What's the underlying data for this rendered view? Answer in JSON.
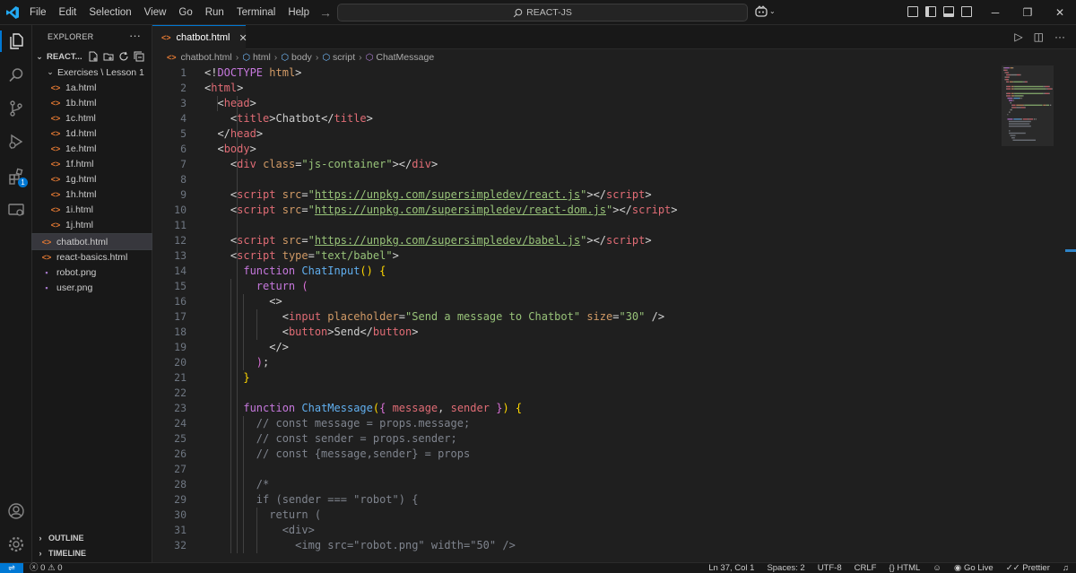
{
  "titlebar": {
    "menu": [
      "File",
      "Edit",
      "Selection",
      "View",
      "Go",
      "Run",
      "Terminal",
      "Help"
    ],
    "search": "REACT-JS"
  },
  "activity": {
    "extensions_badge": "1"
  },
  "sidebar": {
    "title": "EXPLORER",
    "root": "REACT...",
    "folder": "Exercises \\ Lesson 1",
    "files": [
      "1a.html",
      "1b.html",
      "1c.html",
      "1d.html",
      "1e.html",
      "1f.html",
      "1g.html",
      "1h.html",
      "1i.html",
      "1j.html"
    ],
    "root_files": [
      "chatbot.html",
      "react-basics.html",
      "robot.png",
      "user.png"
    ],
    "sections": [
      "OUTLINE",
      "TIMELINE"
    ]
  },
  "editor": {
    "tab": "chatbot.html",
    "breadcrumb": [
      "chatbot.html",
      "html",
      "body",
      "script",
      "ChatMessage"
    ],
    "lines": [
      [
        [
          "t-br",
          "<!"
        ],
        [
          "t-kw",
          "DOCTYPE"
        ],
        [
          "t-txt",
          " "
        ],
        [
          "t-attr",
          "html"
        ],
        [
          "t-br",
          ">"
        ]
      ],
      [
        [
          "t-br",
          "<"
        ],
        [
          "t-tag",
          "html"
        ],
        [
          "t-br",
          ">"
        ]
      ],
      [
        [
          "t-txt",
          "  "
        ],
        [
          "t-br",
          "<"
        ],
        [
          "t-tag",
          "head"
        ],
        [
          "t-br",
          ">"
        ]
      ],
      [
        [
          "t-txt",
          "    "
        ],
        [
          "t-br",
          "<"
        ],
        [
          "t-tag",
          "title"
        ],
        [
          "t-br",
          ">"
        ],
        [
          "t-txt",
          "Chatbot"
        ],
        [
          "t-br",
          "</"
        ],
        [
          "t-tag",
          "title"
        ],
        [
          "t-br",
          ">"
        ]
      ],
      [
        [
          "t-txt",
          "  "
        ],
        [
          "t-br",
          "</"
        ],
        [
          "t-tag",
          "head"
        ],
        [
          "t-br",
          ">"
        ]
      ],
      [
        [
          "t-txt",
          "  "
        ],
        [
          "t-br",
          "<"
        ],
        [
          "t-tag",
          "body"
        ],
        [
          "t-br",
          ">"
        ]
      ],
      [
        [
          "t-txt",
          "    "
        ],
        [
          "t-br",
          "<"
        ],
        [
          "t-tag",
          "div"
        ],
        [
          "t-txt",
          " "
        ],
        [
          "t-attr",
          "class"
        ],
        [
          "t-br",
          "="
        ],
        [
          "t-str",
          "\"js-container\""
        ],
        [
          "t-br",
          "></"
        ],
        [
          "t-tag",
          "div"
        ],
        [
          "t-br",
          ">"
        ]
      ],
      [],
      [
        [
          "t-txt",
          "    "
        ],
        [
          "t-br",
          "<"
        ],
        [
          "t-tag",
          "script"
        ],
        [
          "t-txt",
          " "
        ],
        [
          "t-attr",
          "src"
        ],
        [
          "t-br",
          "="
        ],
        [
          "t-str",
          "\""
        ],
        [
          "t-url",
          "https://unpkg.com/supersimpledev/react.js"
        ],
        [
          "t-str",
          "\""
        ],
        [
          "t-br",
          "></"
        ],
        [
          "t-tag",
          "script"
        ],
        [
          "t-br",
          ">"
        ]
      ],
      [
        [
          "t-txt",
          "    "
        ],
        [
          "t-br",
          "<"
        ],
        [
          "t-tag",
          "script"
        ],
        [
          "t-txt",
          " "
        ],
        [
          "t-attr",
          "src"
        ],
        [
          "t-br",
          "="
        ],
        [
          "t-str",
          "\""
        ],
        [
          "t-url",
          "https://unpkg.com/supersimpledev/react-dom.js"
        ],
        [
          "t-str",
          "\""
        ],
        [
          "t-br",
          "></"
        ],
        [
          "t-tag",
          "script"
        ],
        [
          "t-br",
          ">"
        ]
      ],
      [],
      [
        [
          "t-txt",
          "    "
        ],
        [
          "t-br",
          "<"
        ],
        [
          "t-tag",
          "script"
        ],
        [
          "t-txt",
          " "
        ],
        [
          "t-attr",
          "src"
        ],
        [
          "t-br",
          "="
        ],
        [
          "t-str",
          "\""
        ],
        [
          "t-url",
          "https://unpkg.com/supersimpledev/babel.js"
        ],
        [
          "t-str",
          "\""
        ],
        [
          "t-br",
          "></"
        ],
        [
          "t-tag",
          "script"
        ],
        [
          "t-br",
          ">"
        ]
      ],
      [
        [
          "t-txt",
          "    "
        ],
        [
          "t-br",
          "<"
        ],
        [
          "t-tag",
          "script"
        ],
        [
          "t-txt",
          " "
        ],
        [
          "t-attr",
          "type"
        ],
        [
          "t-br",
          "="
        ],
        [
          "t-str",
          "\"text/babel\""
        ],
        [
          "t-br",
          ">"
        ]
      ],
      [
        [
          "t-txt",
          "      "
        ],
        [
          "t-kw",
          "function"
        ],
        [
          "t-txt",
          " "
        ],
        [
          "t-fn",
          "ChatInput"
        ],
        [
          "t-p1",
          "()"
        ],
        [
          "t-txt",
          " "
        ],
        [
          "t-p1",
          "{"
        ]
      ],
      [
        [
          "t-txt",
          "        "
        ],
        [
          "t-kw",
          "return"
        ],
        [
          "t-txt",
          " "
        ],
        [
          "t-p2",
          "("
        ]
      ],
      [
        [
          "t-txt",
          "          "
        ],
        [
          "t-br",
          "<>"
        ]
      ],
      [
        [
          "t-txt",
          "            "
        ],
        [
          "t-br",
          "<"
        ],
        [
          "t-tag",
          "input"
        ],
        [
          "t-txt",
          " "
        ],
        [
          "t-attr",
          "placeholder"
        ],
        [
          "t-br",
          "="
        ],
        [
          "t-str",
          "\"Send a message to Chatbot\""
        ],
        [
          "t-txt",
          " "
        ],
        [
          "t-attr",
          "size"
        ],
        [
          "t-br",
          "="
        ],
        [
          "t-str",
          "\"30\""
        ],
        [
          "t-txt",
          " "
        ],
        [
          "t-br",
          "/>"
        ]
      ],
      [
        [
          "t-txt",
          "            "
        ],
        [
          "t-br",
          "<"
        ],
        [
          "t-tag",
          "button"
        ],
        [
          "t-br",
          ">"
        ],
        [
          "t-txt",
          "Send"
        ],
        [
          "t-br",
          "</"
        ],
        [
          "t-tag",
          "button"
        ],
        [
          "t-br",
          ">"
        ]
      ],
      [
        [
          "t-txt",
          "          "
        ],
        [
          "t-br",
          "</>"
        ]
      ],
      [
        [
          "t-txt",
          "        "
        ],
        [
          "t-p2",
          ")"
        ],
        [
          "t-txt",
          ";"
        ]
      ],
      [
        [
          "t-txt",
          "      "
        ],
        [
          "t-p1",
          "}"
        ]
      ],
      [],
      [
        [
          "t-txt",
          "      "
        ],
        [
          "t-kw",
          "function"
        ],
        [
          "t-txt",
          " "
        ],
        [
          "t-fn",
          "ChatMessage"
        ],
        [
          "t-p1",
          "("
        ],
        [
          "t-p2",
          "{"
        ],
        [
          "t-txt",
          " "
        ],
        [
          "t-var",
          "message"
        ],
        [
          "t-txt",
          ", "
        ],
        [
          "t-var",
          "sender"
        ],
        [
          "t-txt",
          " "
        ],
        [
          "t-p2",
          "}"
        ],
        [
          "t-p1",
          ")"
        ],
        [
          "t-txt",
          " "
        ],
        [
          "t-p1",
          "{"
        ]
      ],
      [
        [
          "t-txt",
          "        "
        ],
        [
          "t-com",
          "// const message = props.message;"
        ]
      ],
      [
        [
          "t-txt",
          "        "
        ],
        [
          "t-com",
          "// const sender = props.sender;"
        ]
      ],
      [
        [
          "t-txt",
          "        "
        ],
        [
          "t-com",
          "// const {message,sender} = props"
        ]
      ],
      [],
      [
        [
          "t-txt",
          "        "
        ],
        [
          "t-com",
          "/*"
        ]
      ],
      [
        [
          "t-txt",
          "        "
        ],
        [
          "t-com",
          "if (sender === \"robot\") {"
        ]
      ],
      [
        [
          "t-txt",
          "          "
        ],
        [
          "t-com",
          "return ("
        ]
      ],
      [
        [
          "t-txt",
          "            "
        ],
        [
          "t-com",
          "<div>"
        ]
      ],
      [
        [
          "t-txt",
          "              "
        ],
        [
          "t-com",
          "<img src=\"robot.png\" width=\"50\" />"
        ]
      ]
    ]
  },
  "statusbar": {
    "errors": "0",
    "warnings": "0",
    "cursor": "Ln 37, Col 1",
    "spaces": "Spaces: 2",
    "encoding": "UTF-8",
    "eol": "CRLF",
    "language": "HTML",
    "golive": "Go Live",
    "prettier": "Prettier"
  }
}
